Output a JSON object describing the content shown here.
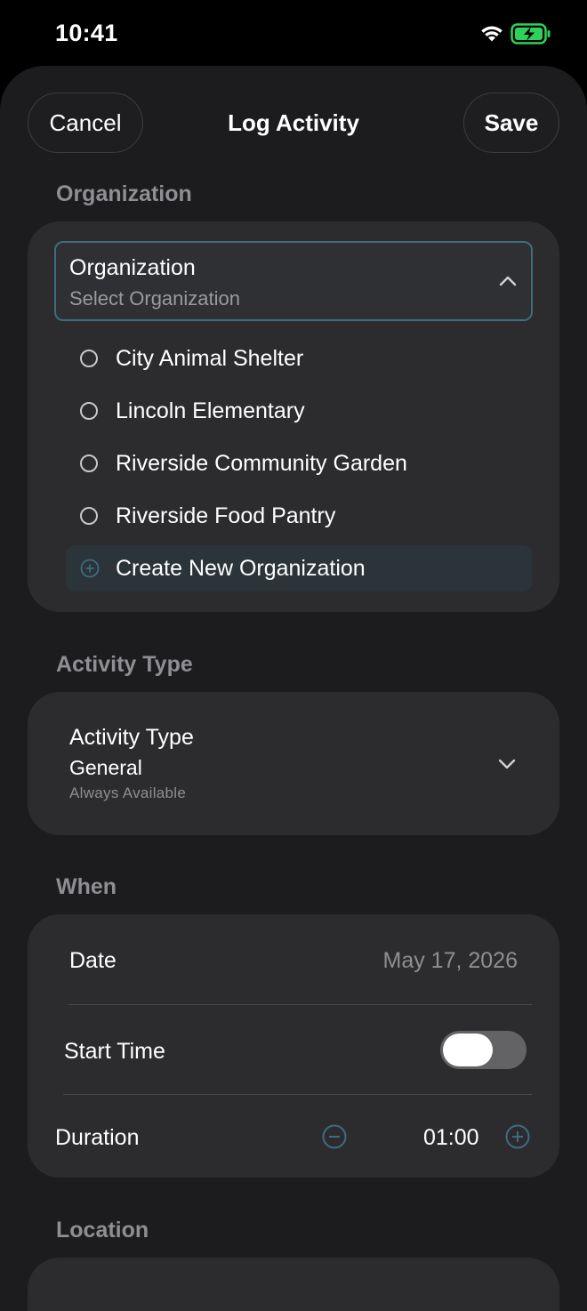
{
  "status_bar": {
    "time": "10:41",
    "icons": [
      "wifi-icon",
      "battery-charging-icon"
    ],
    "battery_color": "#30d158"
  },
  "header": {
    "cancel_label": "Cancel",
    "title": "Log Activity",
    "save_label": "Save"
  },
  "organization": {
    "section_title": "Organization",
    "field_label": "Organization",
    "placeholder": "Select Organization",
    "options": [
      "City Animal Shelter",
      "Lincoln Elementary",
      "Riverside Community Garden",
      "Riverside Food Pantry"
    ],
    "create_label": "Create New Organization",
    "accent_color": "#3f6c80"
  },
  "activity_type": {
    "section_title": "Activity Type",
    "field_label": "Activity Type",
    "value": "General",
    "subtitle": "Always Available"
  },
  "when": {
    "section_title": "When",
    "date_label": "Date",
    "date_value": "May 17, 2026",
    "start_time_label": "Start Time",
    "start_time_enabled": false,
    "duration_label": "Duration",
    "duration_value": "01:00"
  },
  "location": {
    "section_title": "Location"
  }
}
